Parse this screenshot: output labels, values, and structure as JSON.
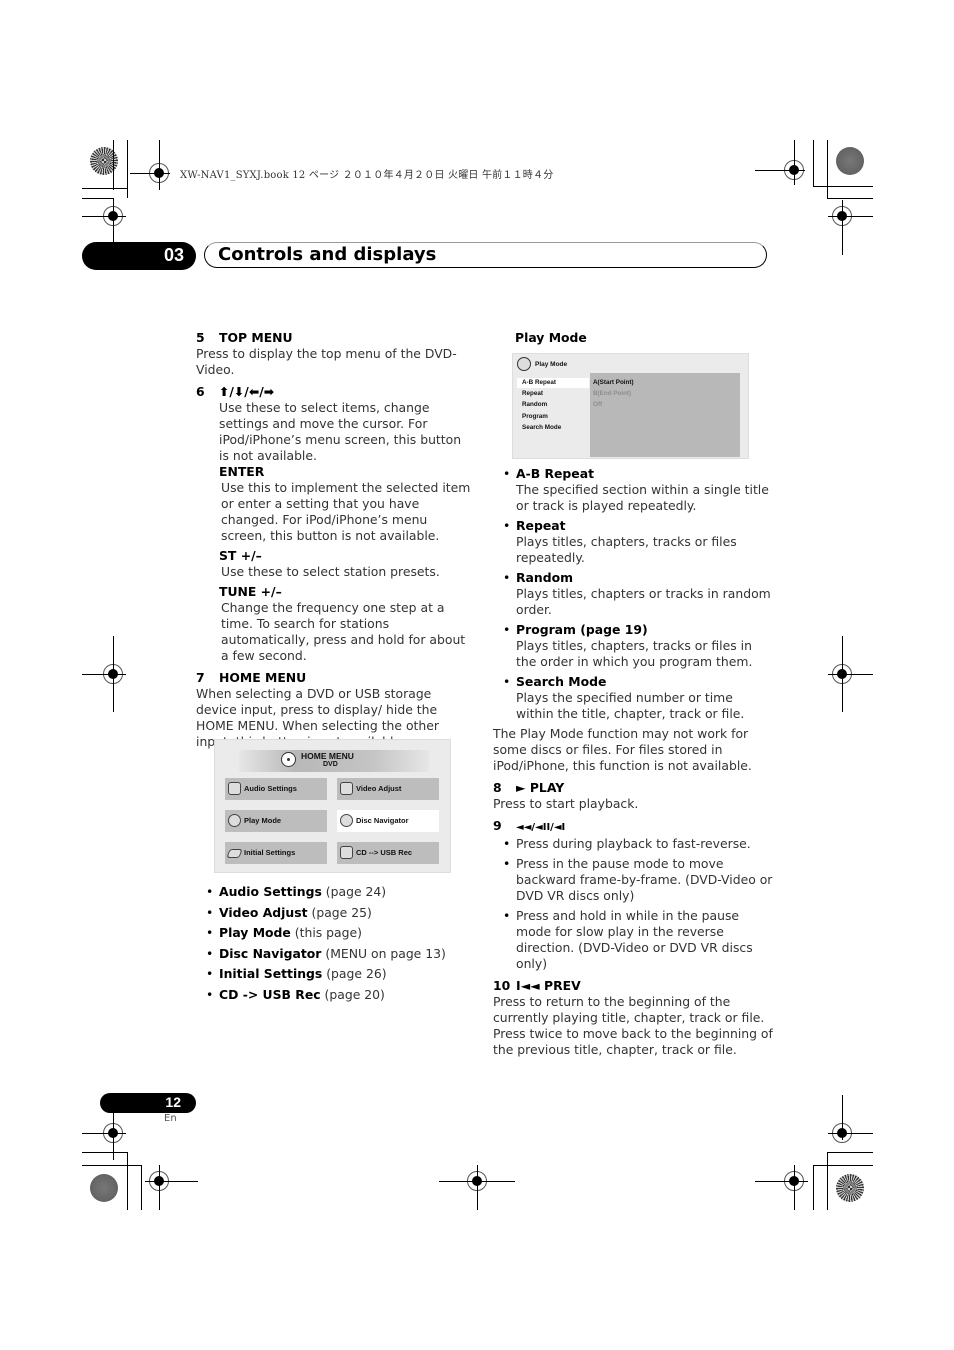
{
  "print_header": "XW-NAV1_SYXJ.book  12 ページ  ２０１０年４月２０日  火曜日  午前１１時４分",
  "chapter": {
    "number": "03",
    "title": "Controls and displays"
  },
  "left_column": {
    "item5": {
      "num": "5",
      "title": "TOP MENU",
      "text": "Press to display the top menu of the DVD-Video."
    },
    "item6": {
      "num": "6",
      "title": "⬆/⬇/⬅/➡",
      "text": "Use these to select items, change settings and move the cursor. For iPod/iPhone’s menu screen, this button is not available.",
      "enter_title": "ENTER",
      "enter_text": "Use this to implement the selected item or enter a setting that you have changed. For iPod/iPhone’s menu screen, this button is not available.",
      "st_title": "ST +/–",
      "st_text": "Use these to select station presets.",
      "tune_title": "TUNE +/–",
      "tune_text": "Change the frequency one step at a time. To search for stations automatically, press and hold for about a few second."
    },
    "item7": {
      "num": "7",
      "title": "HOME MENU",
      "text": "When selecting a DVD or USB storage device input, press to display/ hide the HOME MENU. When selecting the other input, this button is not available."
    },
    "home_menu_screen": {
      "title": "HOME MENU",
      "subtitle": "DVD",
      "buttons": [
        {
          "label": "Audio Settings",
          "icon": "speaker-icon",
          "selected": false
        },
        {
          "label": "Video Adjust",
          "icon": "monitor-icon",
          "selected": false
        },
        {
          "label": "Play Mode",
          "icon": "play-mode-disc-icon",
          "selected": false
        },
        {
          "label": "Disc Navigator",
          "icon": "disc-navigator-icon",
          "selected": true
        },
        {
          "label": "Initial Settings",
          "icon": "settings-tray-icon",
          "selected": false
        },
        {
          "label": "CD --> USB Rec",
          "icon": "usb-rec-icon",
          "selected": false
        }
      ]
    },
    "menu_list": [
      {
        "name": "Audio Settings",
        "ref": "(page 24)"
      },
      {
        "name": "Video Adjust",
        "ref": "(page 25)"
      },
      {
        "name": "Play Mode",
        "ref": "(this page)"
      },
      {
        "name": "Disc Navigator",
        "ref": "(MENU on page 13)"
      },
      {
        "name": "Initial Settings",
        "ref": "(page 26)"
      },
      {
        "name": "CD -> USB Rec",
        "ref": "(page 20)"
      }
    ]
  },
  "right_column": {
    "play_mode_heading": "Play Mode",
    "play_mode_screen": {
      "header": "Play Mode",
      "items": [
        "A-B Repeat",
        "Repeat",
        "Random",
        "Program",
        "Search Mode"
      ],
      "selected_item": "A-B Repeat",
      "options": [
        {
          "label": "A(Start Point)",
          "active": true
        },
        {
          "label": "B(End Point)",
          "active": false
        },
        {
          "label": "Off",
          "active": false
        }
      ]
    },
    "modes": [
      {
        "name": "A-B Repeat",
        "text": "The specified section within a single title or track is played repeatedly."
      },
      {
        "name": "Repeat",
        "text": "Plays titles, chapters, tracks or files repeatedly."
      },
      {
        "name": "Random",
        "text": "Plays titles, chapters or tracks in random order."
      },
      {
        "name": "Program (page 19)",
        "text": "Plays titles, chapters, tracks or files in the order in which you program them."
      },
      {
        "name": "Search Mode",
        "text": "Plays the specified number or time within the title, chapter, track or file."
      }
    ],
    "note": "The Play Mode function may not work for some discs or files. For files stored in iPod/iPhone, this function is not available.",
    "item8": {
      "num": "8",
      "title": "► PLAY",
      "text": "Press to start playback."
    },
    "item9": {
      "num": "9",
      "title": "◄◄/◄II/◄I",
      "bullets": [
        "Press during playback to fast-reverse.",
        "Press in the pause mode to move backward frame-by-frame. (DVD-Video or DVD VR discs only)",
        "Press and hold in while in the pause mode for slow play in the reverse direction. (DVD-Video or DVD VR discs only)"
      ]
    },
    "item10": {
      "num": "10",
      "title": "I◄◄ PREV",
      "text": "Press to return to the beginning of the currently playing title, chapter, track or file. Press twice to move back to the beginning of the previous title, chapter, track or file."
    }
  },
  "footer": {
    "page_number": "12",
    "language": "En"
  }
}
